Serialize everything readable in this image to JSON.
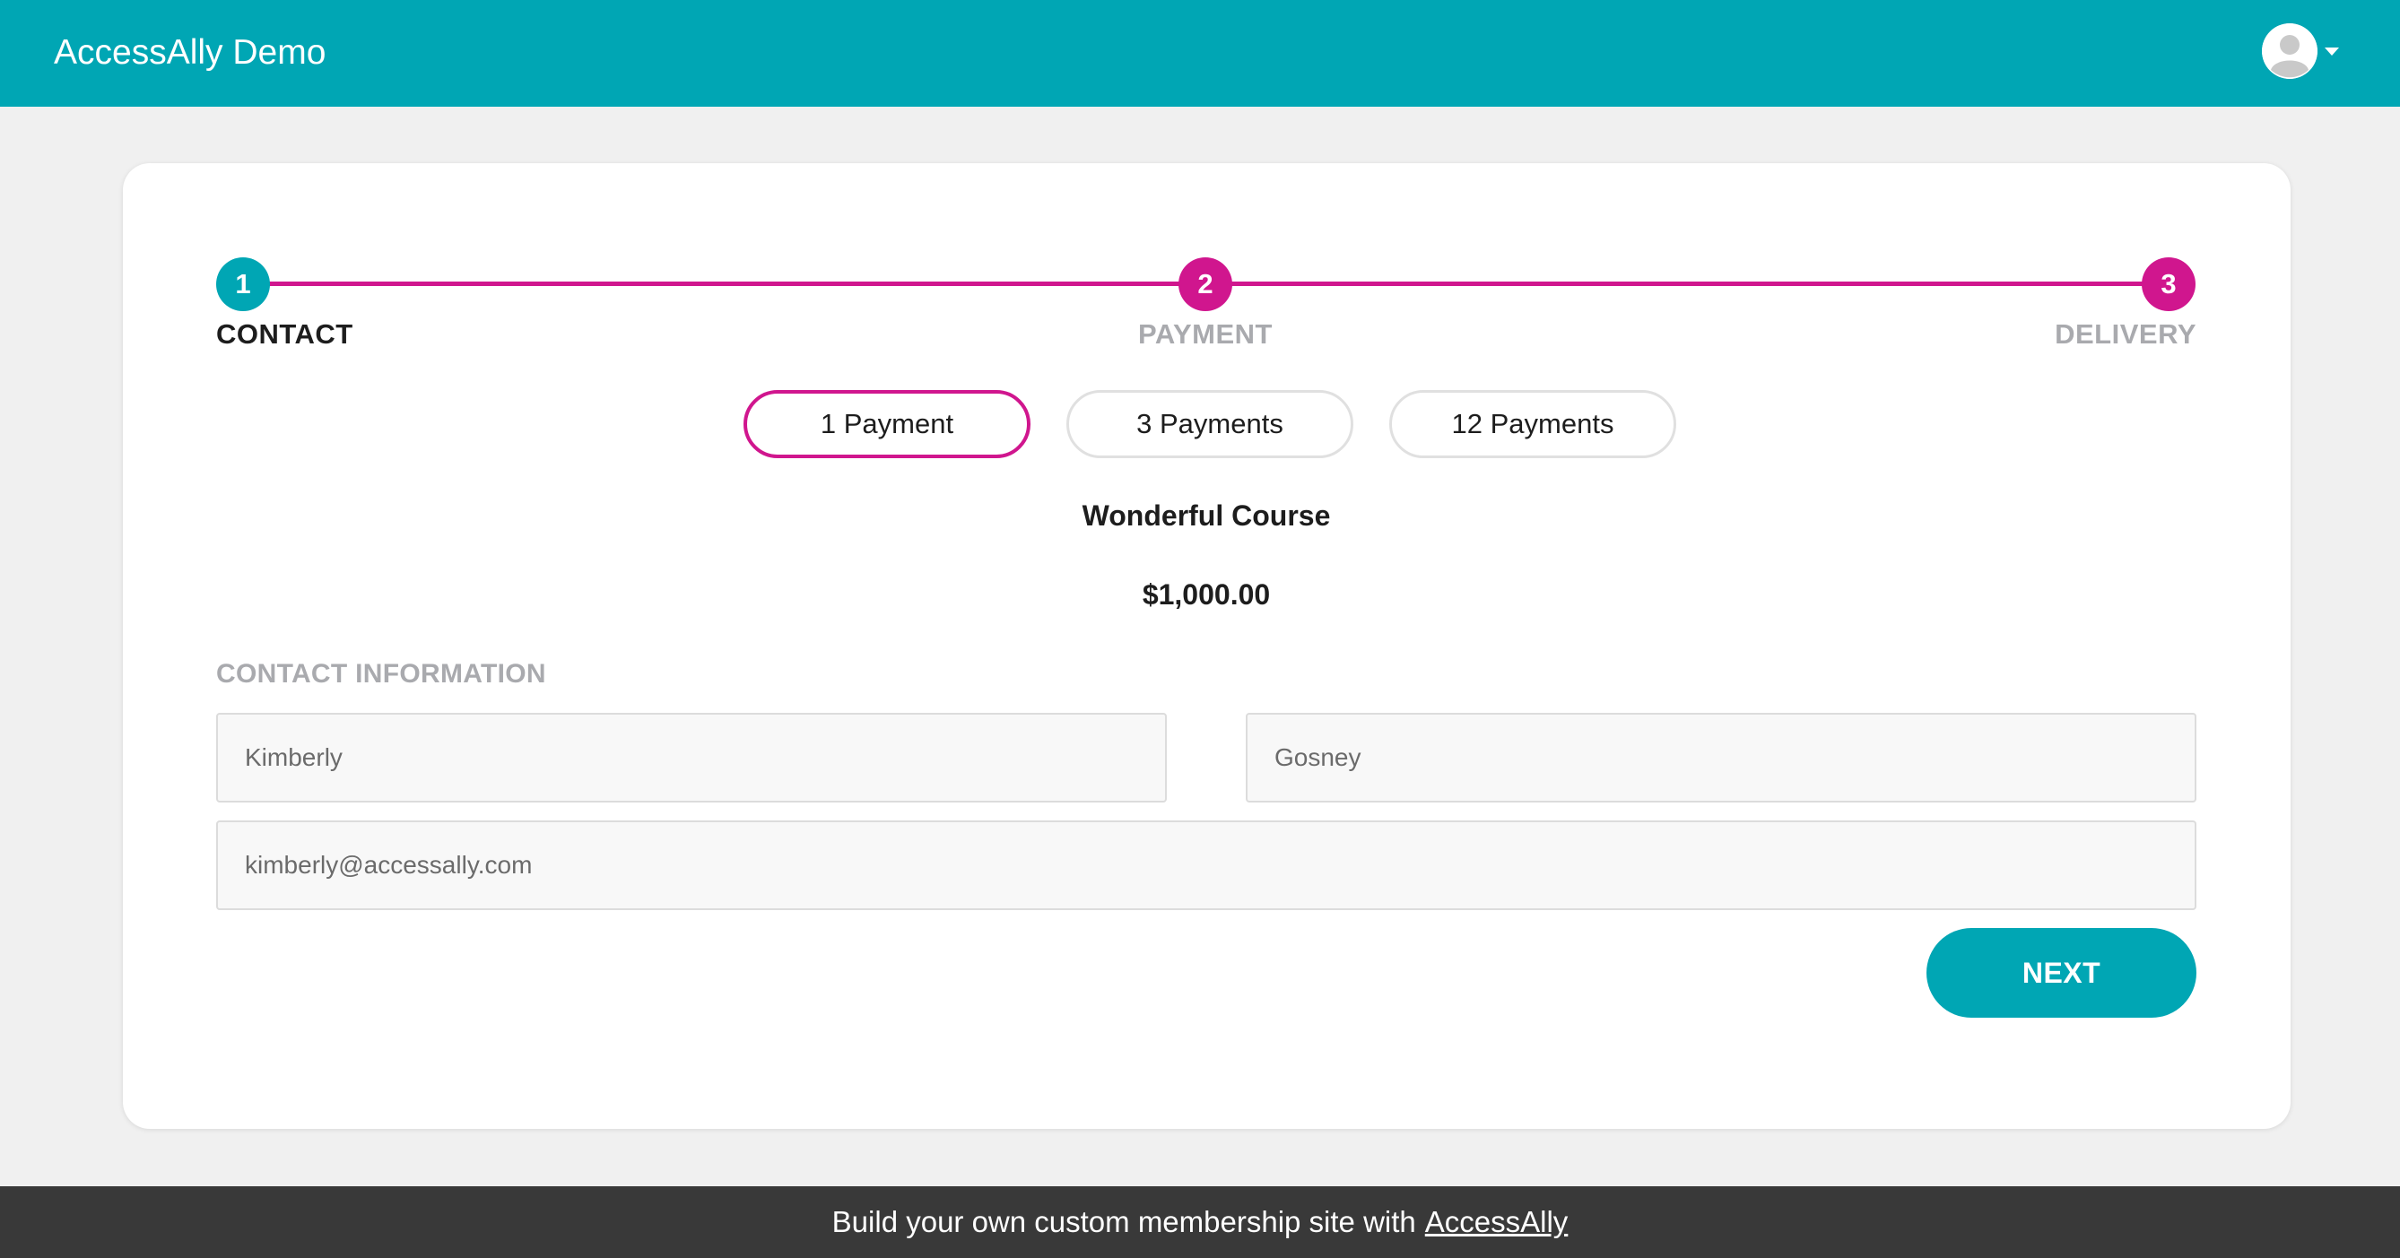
{
  "header": {
    "brand": "AccessAlly Demo",
    "user_icon": "user-avatar-icon",
    "menu_icon": "caret-down-icon"
  },
  "stepper": {
    "steps": [
      {
        "number": "1",
        "label": "CONTACT",
        "state": "current"
      },
      {
        "number": "2",
        "label": "PAYMENT",
        "state": "upcoming"
      },
      {
        "number": "3",
        "label": "DELIVERY",
        "state": "upcoming"
      }
    ]
  },
  "payment_options": [
    {
      "label": "1 Payment",
      "selected": true
    },
    {
      "label": "3 Payments",
      "selected": false
    },
    {
      "label": "12 Payments",
      "selected": false
    }
  ],
  "product": {
    "name": "Wonderful Course",
    "price": "$1,000.00"
  },
  "contact": {
    "section_label": "CONTACT INFORMATION",
    "first_name": "Kimberly",
    "last_name": "Gosney",
    "email": "kimberly@accessally.com"
  },
  "actions": {
    "next_label": "NEXT"
  },
  "footer": {
    "text": "Build your own custom membership site with",
    "link_label": "AccessAlly"
  },
  "colors": {
    "primary": "#00a6b4",
    "accent": "#d0168e",
    "muted_text": "#a9aaae",
    "footer_bg": "#393939"
  }
}
